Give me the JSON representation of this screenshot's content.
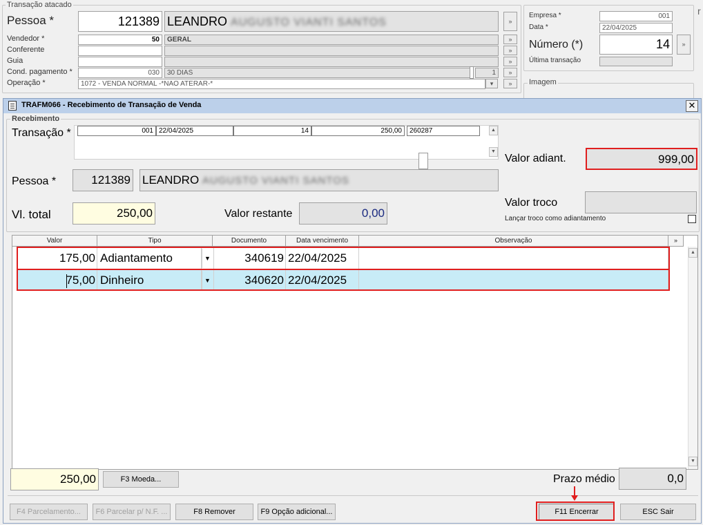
{
  "bg": {
    "group_title": "Transação atacado",
    "pessoa_label": "Pessoa *",
    "pessoa_code": "121389",
    "pessoa_name": "LEANDRO",
    "pessoa_blur": "AUGUSTO VIANTI SANTOS",
    "vendedor_label": "Vendedor *",
    "vendedor_code": "50",
    "vendedor_name": "GERAL",
    "conferente_label": "Conferente",
    "guia_label": "Guia",
    "cond_label": "Cond. pagamento *",
    "cond_code": "030",
    "cond_name": "30 DIAS",
    "cond_count": "1",
    "operacao_label": "Operação *",
    "operacao_value": "1072 - VENDA NORMAL -*NAO ATERAR-*",
    "empresa_label": "Empresa *",
    "empresa_value": "001",
    "data_label": "Data *",
    "data_value": "22/04/2025",
    "numero_label": "Número (*)",
    "numero_value": "14",
    "ultima_label": "Última transação",
    "imagem_title": "Imagem",
    "edge_char": "r"
  },
  "dialog": {
    "title": "TRAFM066 - Recebimento de Transação de Venda",
    "group_title": "Recebimento",
    "transacao_label": "Transação *",
    "transacao_row": [
      "001",
      "22/04/2025",
      "14",
      "250,00",
      "260287"
    ],
    "pessoa_label": "Pessoa *",
    "pessoa_code": "121389",
    "pessoa_name": "LEANDRO",
    "pessoa_blur": "AUGUSTO VIANTI SANTOS",
    "vl_total_label": "Vl. total",
    "vl_total_value": "250,00",
    "valor_restante_label": "Valor restante",
    "valor_restante_value": "0,00",
    "valor_adiant_label": "Valor adiant.",
    "valor_adiant_value": "999,00",
    "valor_troco_label": "Valor troco",
    "valor_troco_value": "",
    "lancar_troco_label": "Lançar troco como adiantamento",
    "grid": {
      "headers": [
        "Valor",
        "Tipo",
        "Documento",
        "Data vencimento",
        "Observação"
      ],
      "rows": [
        {
          "valor": "175,00",
          "tipo": "Adiantamento",
          "documento": "340619",
          "data": "22/04/2025",
          "obs": ""
        },
        {
          "valor": "75,00",
          "tipo": "Dinheiro",
          "documento": "340620",
          "data": "22/04/2025",
          "obs": ""
        }
      ]
    },
    "total_value": "250,00",
    "moeda_button": "F3 Moeda...",
    "prazo_medio_label": "Prazo médio",
    "prazo_medio_value": "0,0",
    "buttons": {
      "parcelamento": "F4 Parcelamento...",
      "parcelar_nf": "F6 Parcelar p/ N.F. ...",
      "remover": "F8 Remover",
      "opcao_adicional": "F9 Opção adicional...",
      "encerrar": "F11 Encerrar",
      "sair": "ESC Sair"
    },
    "colors": {
      "highlight": "#e01e1e",
      "selected_row": "#c8ecf7",
      "yellow_field": "#fffde1",
      "titlebar": "#bcd0ea"
    }
  }
}
